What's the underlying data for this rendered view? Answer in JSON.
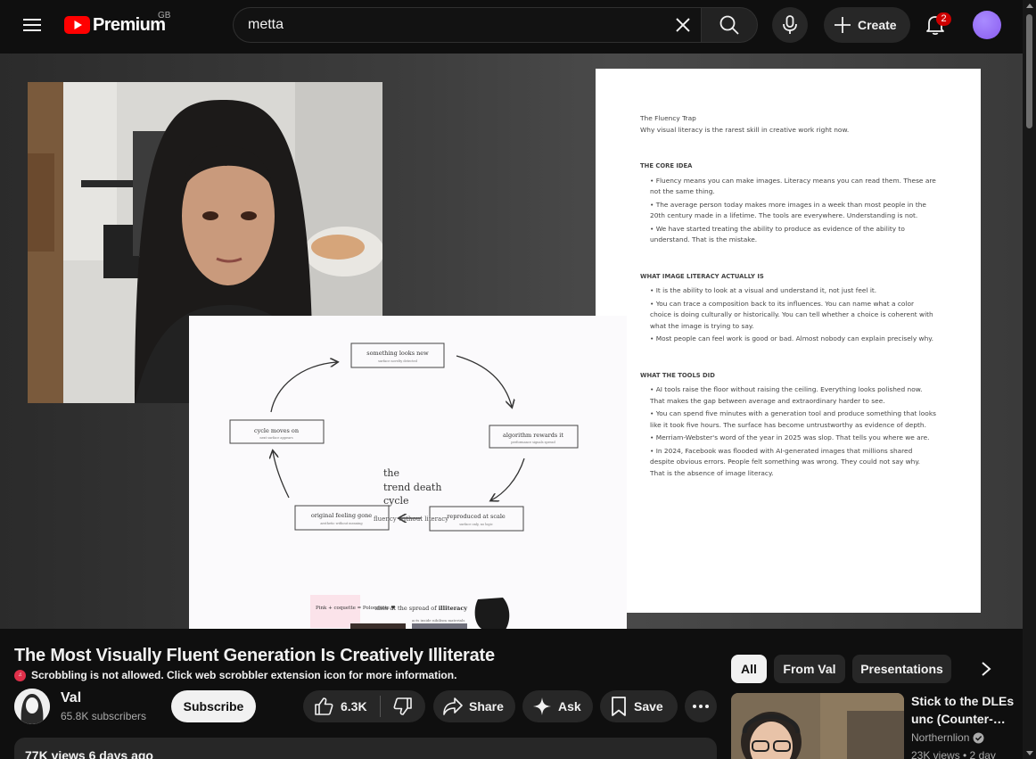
{
  "header": {
    "logo_text": "Premium",
    "country_code": "GB",
    "search": {
      "value": "metta",
      "placeholder": "Search"
    },
    "create_label": "Create",
    "notification_count": "2",
    "brand_color": "#ff0000"
  },
  "video": {
    "title": "The Most Visually Fluent Generation Is Creatively Illiterate",
    "scrobbler_message": "Scrobbling is not allowed. Click web scrobbler extension icon for more information.",
    "channel_name": "Val",
    "subscriber_count": "65.8K subscribers",
    "subscribe_label": "Subscribe",
    "like_count": "6.3K",
    "share_label": "Share",
    "ask_label": "Ask",
    "save_label": "Save",
    "stats": "77K views  6 days ago"
  },
  "slide_doc": {
    "title_line": "The Fluency Trap",
    "subtitle_line": "Why visual literacy is the rarest skill in creative work right now.",
    "sections": [
      {
        "heading": "THE CORE IDEA",
        "bullets": [
          "• Fluency means you can make images. Literacy means you can read them. These are not the same thing.",
          "• The average person today makes more images in a week than most people in the 20th century made in a lifetime. The tools are everywhere. Understanding is not.",
          "• We have started treating the ability to produce as evidence of the ability to understand. That is the mistake."
        ]
      },
      {
        "heading": "WHAT IMAGE LITERACY ACTUALLY IS",
        "bullets": [
          "• It is the ability to look at a visual and understand it, not just feel it.",
          "• You can trace a composition back to its influences. You can name what a color choice is doing culturally or historically. You can tell whether a choice is coherent with what the image is trying to say.",
          "• Most people can feel work is good or bad. Almost nobody can explain precisely why."
        ]
      },
      {
        "heading": "WHAT THE TOOLS DID",
        "bullets": [
          "• AI tools raise the floor without raising the ceiling. Everything looks polished now. That makes the gap between average and extraordinary harder to see.",
          "• You can spend five minutes with a generation tool and produce something that looks like it took five hours. The surface has become untrustworthy as evidence of depth.",
          "• Merriam-Webster's word of the year in 2025 was slop. That tells you where we are.",
          "• In 2024, Facebook was flooded with AI-generated images that millions shared despite obvious errors. People felt something was wrong. They could not say why. That is the absence of image literacy."
        ]
      }
    ]
  },
  "diagram": {
    "center_title": [
      "the",
      "trend death",
      "cycle"
    ],
    "center_caption": "fluency without literacy",
    "nodes": {
      "top": {
        "label": "something looks new",
        "sub": "surface novelty detected"
      },
      "right": {
        "label": "algorithm rewards it",
        "sub": "performance signals spread"
      },
      "bottom_right": {
        "label": "reproduced at scale",
        "sub": "surface only, no logic"
      },
      "bottom_left": {
        "label": "original feeling gone",
        "sub": "aesthetic without meaning"
      },
      "left": {
        "label": "cycle moves on",
        "sub": "next surface appears"
      }
    },
    "moodboard_note_1": "Pink + coquette = Poloquette ♥",
    "moodboard_caption": "dies at the spread of",
    "moodboard_caption_bold": "illiteracy",
    "moodboard_sub": "acts inside nihilism materials"
  },
  "related": {
    "chips": [
      "All",
      "From Val",
      "Presentations"
    ],
    "items": [
      {
        "title": "Stick to the DLEs unc (Counter-…",
        "channel": "Northernlion",
        "meta": "23K views • 2 day"
      }
    ]
  }
}
